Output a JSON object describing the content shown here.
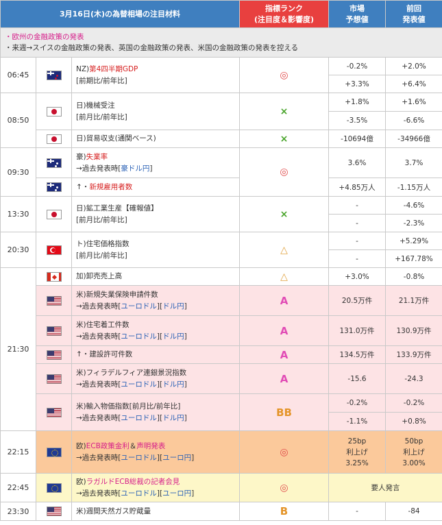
{
  "header": {
    "title": "3月16日(木)の為替相場の注目材料",
    "rank_line1": "指標ランク",
    "rank_line2": "(注目度＆影響度)",
    "forecast_line1": "市場",
    "forecast_line2": "予想値",
    "previous_line1": "前回",
    "previous_line2": "発表値"
  },
  "notes": {
    "line1": "・欧州の金融政策の発表",
    "line2": "・来週→スイスの金融政策の発表、英国の金融政策の発表、米国の金融政策の発表を控える"
  },
  "times": {
    "t0645": "06:45",
    "t0850": "08:50",
    "t0930": "09:30",
    "t1330": "13:30",
    "t2030": "20:30",
    "t2130": "21:30",
    "t2215": "22:15",
    "t2245": "22:45",
    "t2330": "23:30"
  },
  "marks": {
    "double_circle": "◎",
    "cross": "×",
    "triangle": "△",
    "A": "A",
    "BB": "BB",
    "B": "B"
  },
  "flags": {
    "nz": "flag-new-zealand",
    "jp": "flag-japan",
    "au": "flag-australia",
    "tr": "flag-turkey",
    "ca": "flag-canada",
    "us": "flag-united-states",
    "eu": "flag-eu"
  },
  "rows": {
    "nz_gdp": {
      "prefix": "NZ)",
      "name": "第4四半期GDP",
      "sub": "[前期比/前年比]",
      "fc1": "-0.2%",
      "pv1": "+2.0%",
      "fc2": "+3.3%",
      "pv2": "+6.4%"
    },
    "jp_machine": {
      "name": "日)機械受注",
      "sub": "[前月比/前年比]",
      "fc1": "+1.8%",
      "pv1": "+1.6%",
      "fc2": "-3.5%",
      "pv2": "-6.6%"
    },
    "jp_trade": {
      "name": "日)貿易収支(通関ベース)",
      "fc": "-10694億",
      "pv": "-34966億"
    },
    "au_unemp": {
      "prefix": "豪)",
      "name": "失業率",
      "sub_prefix": "→過去発表時[",
      "sub_link": "豪ドル円",
      "sub_suffix": "]",
      "fc": "3.6%",
      "pv": "3.7%"
    },
    "au_emp": {
      "arrow": "↑・",
      "name": "新規雇用者数",
      "fc": "+4.85万人",
      "pv": "-1.15万人"
    },
    "jp_ip": {
      "name": "日)鉱工業生産【確報値】",
      "sub": "[前月比/前年比]",
      "fc1": "-",
      "pv1": "-4.6%",
      "fc2": "-",
      "pv2": "-2.3%"
    },
    "tr_house": {
      "name": "ト)住宅価格指数",
      "sub": "[前月比/前年比]",
      "fc1": "-",
      "pv1": "+5.29%",
      "fc2": "-",
      "pv2": "+167.78%"
    },
    "ca_wholesale": {
      "name": "加)卸売売上高",
      "fc": "+3.0%",
      "pv": "-0.8%"
    },
    "us_claims": {
      "name": "米)新規失業保険申請件数",
      "sub_prefix": "→過去発表時[",
      "link1": "ユーロドル",
      "link2": "ドル円",
      "fc": "20.5万件",
      "pv": "21.1万件"
    },
    "us_starts": {
      "name": "米)住宅着工件数",
      "sub_prefix": "→過去発表時[",
      "link1": "ユーロドル",
      "link2": "ドル円",
      "fc": "131.0万件",
      "pv": "130.9万件"
    },
    "us_permits": {
      "arrow": "↑・",
      "name": "建設許可件数",
      "fc": "134.5万件",
      "pv": "133.9万件"
    },
    "us_philly": {
      "name": "米)フィラデルフィア連銀景況指数",
      "sub_prefix": "→過去発表時[",
      "link1": "ユーロドル",
      "link2": "ドル円",
      "fc": "-15.6",
      "pv": "-24.3"
    },
    "us_import": {
      "name": "米)輸入物価指数",
      "name_suffix": "[前月比/前年比]",
      "sub_prefix": "→過去発表時[",
      "link1": "ユーロドル",
      "link2": "ドル円",
      "fc1": "-0.2%",
      "pv1": "-0.2%",
      "fc2": "-1.1%",
      "pv2": "+0.8%"
    },
    "eu_ecb": {
      "prefix": "欧)",
      "name": "ECB政策金利",
      "amp": "＆",
      "name2": "声明発表",
      "sub_prefix": "→過去発表時[",
      "link1": "ユーロドル",
      "link2": "ユーロ円",
      "fc_l1": "25bp",
      "fc_l2": "利上げ",
      "fc_l3": "3.25%",
      "pv_l1": "50bp",
      "pv_l2": "利上げ",
      "pv_l3": "3.00%"
    },
    "eu_lagarde": {
      "prefix": "欧)",
      "name": "ラガルドECB総裁の記者会見",
      "sub_prefix": "→過去発表時[",
      "link1": "ユーロドル",
      "link2": "ユーロ円",
      "span_text": "要人発言"
    },
    "us_gas": {
      "name": "米)週間天然ガス貯蔵量",
      "fc": "-",
      "pv": "-84"
    }
  }
}
